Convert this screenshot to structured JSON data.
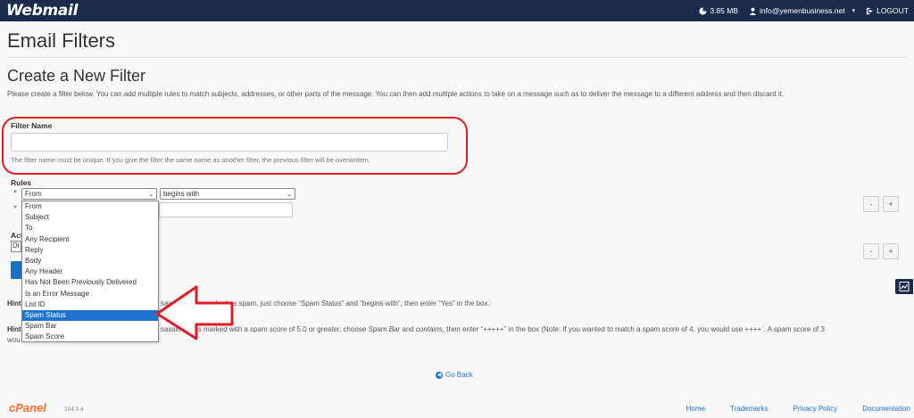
{
  "topbar": {
    "logo": "Webmail",
    "disk_usage": "3.85 MB",
    "user_email": "info@yemenbusiness.net",
    "logout_label": "LOGOUT"
  },
  "page": {
    "title": "Email Filters",
    "section_title": "Create a New Filter",
    "description": "Please create a filter below. You can add multiple rules to match subjects, addresses, or other parts of the message. You can then add multiple actions to take on a message such as to deliver the message to a different address and then discard it."
  },
  "filter_name": {
    "label": "Filter Name",
    "value": "",
    "help": "The filter name must be unique. If you give the filter the same name as another filter, the previous filter will be overwritten."
  },
  "rules": {
    "label": "Rules",
    "field_selected": "From",
    "operator_selected": "begins with",
    "field_options": [
      "From",
      "Subject",
      "To",
      "Any Recipient",
      "Reply",
      "Body",
      "Any Header",
      "Has Not Been Previously Delivered",
      "Is an Error Message",
      "List ID",
      "Spam Status",
      "Spam Bar",
      "Spam Score"
    ],
    "highlighted_option": "Spam Status",
    "minus_label": "-",
    "plus_label": "+"
  },
  "actions": {
    "label": "Act",
    "action_selected": "Di",
    "minus_label": "-",
    "plus_label": "+"
  },
  "create_button": {
    "label": "C"
  },
  "hints": {
    "hint1_prefix": "Hint",
    "hint1_text": "sassin™ has marked as spam, just choose “Spam Status” and “begins with”, then enter “Yes” in the box.",
    "hint2_prefix": "Hint",
    "hint2_text_a": "sassin™ has marked with a spam score of 5.0 or greater, choose",
    "hint2_em1": "Spam Bar",
    "hint2_and": "and",
    "hint2_em2": "contains,",
    "hint2_text_b": "then enter “+++++” in the box (Note: If you wanted to match a spam score of 4, you would use ++++`. A spam score of 3",
    "hint2_line2": "wou"
  },
  "go_back": "Go Back",
  "footer": {
    "logo": "cPanel",
    "version": "104.0.4",
    "links": [
      "Home",
      "Trademarks",
      "Privacy Policy",
      "Documentation"
    ]
  },
  "colors": {
    "topbar": "#1a2b4c",
    "accent": "#1e73d1",
    "highlight_annotation": "#e01b24",
    "cpanel_orange": "#ff6c2c"
  }
}
